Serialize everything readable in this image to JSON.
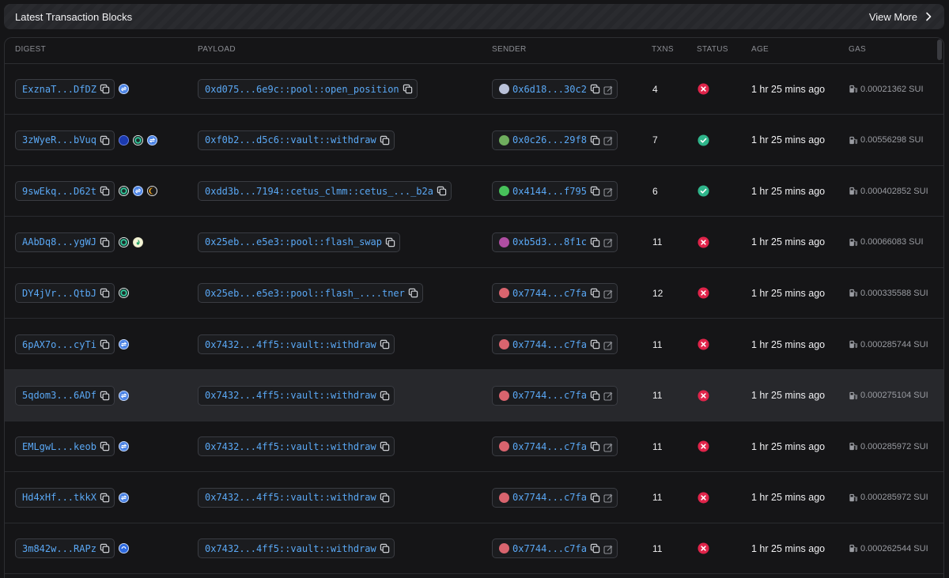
{
  "header": {
    "title": "Latest Transaction Blocks",
    "view_more": "View More"
  },
  "columns": [
    "DIGEST",
    "PAYLOAD",
    "SENDER",
    "TXNS",
    "STATUS",
    "AGE",
    "GAS"
  ],
  "colors": {
    "link": "#5aa8f5",
    "success": "#2fb58b",
    "failure": "#e0244a"
  },
  "rows": [
    {
      "digest": "ExznaT...DfDZ",
      "protocols": [
        "blue-swap"
      ],
      "payload": "0xd075...6e9c::pool::open_position",
      "sender": "0x6d18...30c2",
      "avatar": "#b9c1d9",
      "txns": "4",
      "status": "failure",
      "age": "1 hr 25 mins ago",
      "gas": "0.00021362 SUI"
    },
    {
      "digest": "3zWyeR...bVuq",
      "protocols": [
        "navy",
        "teal-ring",
        "blue-swap"
      ],
      "payload": "0xf0b2...d5c6::vault::withdraw",
      "sender": "0x0c26...29f8",
      "avatar": "#6fae5e",
      "txns": "7",
      "status": "success",
      "age": "1 hr 25 mins ago",
      "gas": "0.00556298 SUI"
    },
    {
      "digest": "9swEkq...D62t",
      "protocols": [
        "teal-ring",
        "blue-swap",
        "orange-moon"
      ],
      "payload": "0xdd3b...7194::cetus_clmm::cetus_..._b2a",
      "sender": "0x4144...f795",
      "avatar": "#47c25a",
      "txns": "6",
      "status": "success",
      "age": "1 hr 25 mins ago",
      "gas": "0.000402852 SUI"
    },
    {
      "digest": "AAbDq8...ygWJ",
      "protocols": [
        "teal-ring",
        "flame"
      ],
      "payload": "0x25eb...e5e3::pool::flash_swap",
      "sender": "0xb5d3...8f1c",
      "avatar": "#b04ea3",
      "txns": "11",
      "status": "failure",
      "age": "1 hr 25 mins ago",
      "gas": "0.00066083 SUI"
    },
    {
      "digest": "DY4jVr...QtbJ",
      "protocols": [
        "teal-ring"
      ],
      "payload": "0x25eb...e5e3::pool::flash_....tner",
      "sender": "0x7744...c7fa",
      "avatar": "#d9646e",
      "txns": "12",
      "status": "failure",
      "age": "1 hr 25 mins ago",
      "gas": "0.000335588 SUI"
    },
    {
      "digest": "6pAX7o...cyTi",
      "protocols": [
        "blue-swap"
      ],
      "payload": "0x7432...4ff5::vault::withdraw",
      "sender": "0x7744...c7fa",
      "avatar": "#d9646e",
      "txns": "11",
      "status": "failure",
      "age": "1 hr 25 mins ago",
      "gas": "0.000285744 SUI"
    },
    {
      "digest": "5qdom3...6ADf",
      "protocols": [
        "blue-swap"
      ],
      "payload": "0x7432...4ff5::vault::withdraw",
      "sender": "0x7744...c7fa",
      "avatar": "#d9646e",
      "txns": "11",
      "status": "failure",
      "age": "1 hr 25 mins ago",
      "gas": "0.000275104 SUI"
    },
    {
      "digest": "EMLgwL...keob",
      "protocols": [
        "blue-swap"
      ],
      "payload": "0x7432...4ff5::vault::withdraw",
      "sender": "0x7744...c7fa",
      "avatar": "#d9646e",
      "txns": "11",
      "status": "failure",
      "age": "1 hr 25 mins ago",
      "gas": "0.000285972 SUI"
    },
    {
      "digest": "Hd4xHf...tkkX",
      "protocols": [
        "blue-swap"
      ],
      "payload": "0x7432...4ff5::vault::withdraw",
      "sender": "0x7744...c7fa",
      "avatar": "#d9646e",
      "txns": "11",
      "status": "failure",
      "age": "1 hr 25 mins ago",
      "gas": "0.000285972 SUI"
    },
    {
      "digest": "3m842w...RAPz",
      "protocols": [
        "blue-dot"
      ],
      "payload": "0x7432...4ff5::vault::withdraw",
      "sender": "0x7744...c7fa",
      "avatar": "#d9646e",
      "txns": "11",
      "status": "failure",
      "age": "1 hr 25 mins ago",
      "gas": "0.000262544 SUI"
    }
  ]
}
